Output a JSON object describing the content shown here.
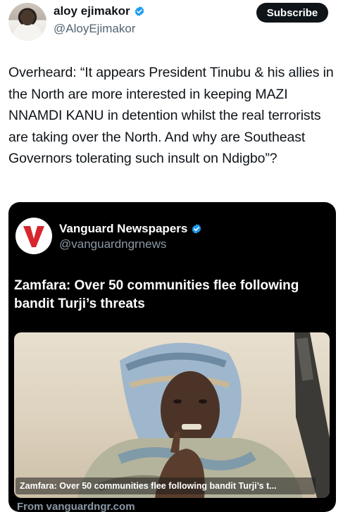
{
  "author": {
    "name": "aloy ejimakor",
    "handle": "@AloyEjimakor",
    "verified_icon": "verified-badge-icon"
  },
  "subscribe_label": "Subscribe",
  "tweet": {
    "text": "Overheard: “It appears President Tinubu & his allies in the North are more interested in keeping MAZI NNAMDI KANU in detention whilst the real terrorists are taking over the North. And why are Southeast Governors tolerating such insult on Ndigbo”?"
  },
  "quoted_card": {
    "logo_letter": "V",
    "name": "Vanguard Newspapers",
    "handle": "@vanguardngrnews",
    "headline": "Zamfara: Over 50 communities flee following bandit Turji’s threats",
    "image_caption": "Zamfara: Over 50 communities flee following bandit Turji’s t...",
    "source": "From vanguardngr.com"
  },
  "colors": {
    "primary_text": "#0f1419",
    "secondary_text": "#536471",
    "verified_blue": "#1d9bf0",
    "card_bg": "#000000",
    "logo_red": "#d7262c"
  }
}
